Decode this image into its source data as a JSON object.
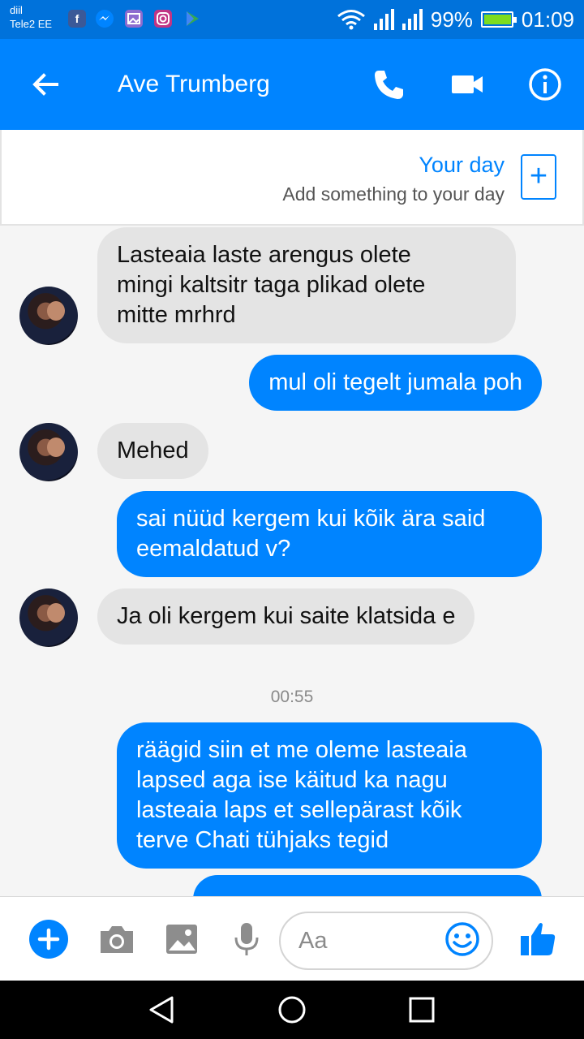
{
  "status_bar": {
    "carrier_line1": "diil",
    "carrier_line2": "Tele2 EE",
    "notification_icons": [
      "facebook-icon",
      "messenger-icon",
      "gallery-icon",
      "instagram-icon",
      "play-store-icon"
    ],
    "battery": "99%",
    "time": "01:09"
  },
  "header": {
    "title": "Ave Trumberg",
    "icons": [
      "back-arrow-icon",
      "phone-icon",
      "video-camera-icon",
      "info-icon"
    ]
  },
  "your_day": {
    "title": "Your day",
    "subtitle": "Add something to your day",
    "add_symbol": "+"
  },
  "messages": [
    {
      "from": "them",
      "text": "Lasteaia laste arengus olete\nmingi kaltsitr taga plikad olete\nmitte mrhrd"
    },
    {
      "from": "me",
      "text": "mul oli tegelt jumala poh"
    },
    {
      "from": "them",
      "text": "Mehed"
    },
    {
      "from": "me",
      "text": "sai nüüd kergem kui kõik ära said\neemaldatud v?"
    },
    {
      "from": "them",
      "text": "Ja oli kergem kui saite klatsida e"
    },
    {
      "timestamp": "00:55"
    },
    {
      "from": "me",
      "text": "räägid siin et me oleme lasteaia\nlapsed aga ise käitud ka nagu\nlasteaia laps et sellepärast kõik\nterve Chati tühjaks tegid"
    }
  ],
  "composer": {
    "placeholder": "Aa",
    "icons": [
      "plus-icon",
      "camera-icon",
      "image-icon",
      "microphone-icon",
      "emoji-icon",
      "thumbs-up-icon"
    ]
  },
  "colors": {
    "brand_blue": "#0084ff",
    "status_blue": "#0072db",
    "incoming_bubble": "#e4e4e4",
    "chat_background": "#f5f5f5"
  }
}
